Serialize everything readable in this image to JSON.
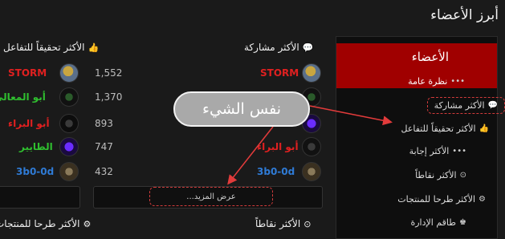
{
  "page": {
    "title": "أبرز الأعضاء"
  },
  "sidebar": {
    "header": "الأعضاء",
    "items": [
      {
        "label": "نظرة عامة",
        "icon": "ellipsis-icon"
      },
      {
        "label": "الأكثر مشاركة",
        "icon": "comments-icon"
      },
      {
        "label": "الأكثر تحقيقاً للتفاعل",
        "icon": "thumbs-up-icon"
      },
      {
        "label": "الأكثر إجابة",
        "icon": "ellipsis-icon"
      },
      {
        "label": "الأكثر نقاطاً",
        "icon": "target-icon"
      },
      {
        "label": "الأكثر طرحا للمنتجات",
        "icon": "gear-icon"
      },
      {
        "label": "طاقم الإدارة",
        "icon": "staff-icon"
      }
    ]
  },
  "columns": {
    "most_posts": {
      "title": "الأكثر مشاركة",
      "users": [
        {
          "name": "STORM",
          "color": "#e02020"
        },
        {
          "name": "",
          "color": "#2fbf2f"
        },
        {
          "name": "",
          "color": "#e02020"
        },
        {
          "name": "أبو البراء",
          "color": "#e02020"
        },
        {
          "name": "3b0-0d",
          "color": "#2f7bd6"
        }
      ],
      "more_label": "عرض المزيد..."
    },
    "most_reactions": {
      "title": "الأكثر تحقيقاً للتفاعل",
      "users": [
        {
          "name": "STORM",
          "count": "1,552",
          "color": "#e02020"
        },
        {
          "name": "أبو المعالي",
          "count": "1,370",
          "color": "#2fbf2f"
        },
        {
          "name": "أبو البراء",
          "count": "893",
          "color": "#e02020"
        },
        {
          "name": "الطايير",
          "count": "747",
          "color": "#2fbf2f"
        },
        {
          "name": "3b0-0d",
          "count": "432",
          "color": "#2f7bd6"
        }
      ]
    },
    "most_points": {
      "title": "الأكثر نقاطاً"
    },
    "most_products": {
      "title": "الأكثر طرحا للمنتجات"
    }
  },
  "callout": {
    "text": "نفس الشيء"
  },
  "colors": {
    "accent": "#a00000",
    "annotation": "#d13b3b"
  }
}
